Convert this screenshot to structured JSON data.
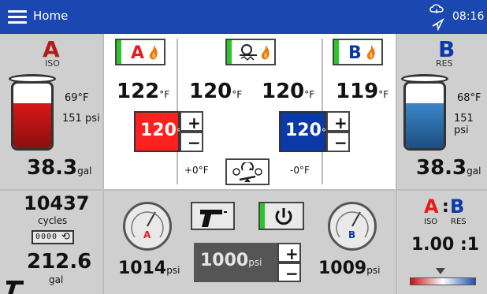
{
  "header": {
    "title": "Home",
    "time": "08:16"
  },
  "side_a": {
    "letter": "A",
    "label": "ISO",
    "temp": "69°F",
    "pressure": "151 psi",
    "volume": "38.3",
    "volume_unit": "gal",
    "fill_percent": 70
  },
  "side_b": {
    "letter": "B",
    "label": "RES",
    "temp": "68°F",
    "pressure": "151 psi",
    "volume": "38.3",
    "volume_unit": "gal",
    "fill_percent": 70
  },
  "zones": {
    "a_label": "A",
    "b_label": "B",
    "a_temp": "122",
    "hose_temp": "120",
    "hose_temp2": "120",
    "b_temp": "119",
    "temp_unit": "°F",
    "a_setpoint": "120",
    "b_setpoint": "120",
    "offset_left": "+0°F",
    "offset_right": "-0°F"
  },
  "counters": {
    "cycles": "10437",
    "cycles_label": "cycles",
    "volume": "212.6",
    "volume_label": "gal",
    "reset_label": "0000"
  },
  "pressures": {
    "a_value": "1014",
    "b_value": "1009",
    "unit": "psi",
    "setpoint": "1000",
    "gauge_a_label": "A",
    "gauge_b_label": "B",
    "plus": "+",
    "minus": "−"
  },
  "ratio": {
    "a": "A",
    "b": "B",
    "iso": "ISO",
    "res": "RES",
    "value": "1.00 :1"
  },
  "colors": {
    "header_blue": "#1a48b0",
    "iso_red": "#ff1f1f",
    "res_blue": "#0b3aa8",
    "ok_green": "#2bc52b"
  }
}
